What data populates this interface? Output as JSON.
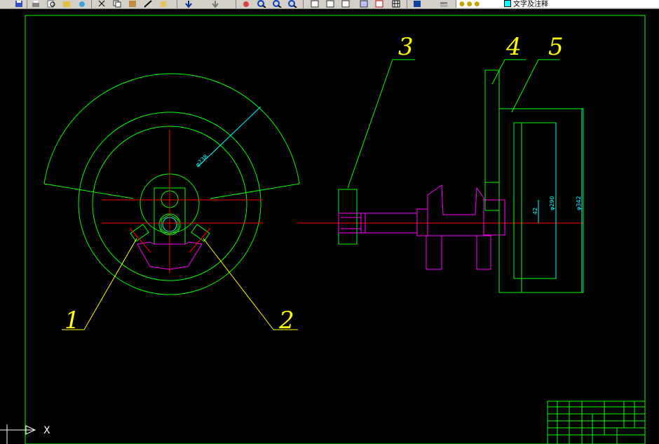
{
  "toolbar": {
    "buttons": [
      "save-icon",
      "print-icon",
      "preview-icon",
      "publish-icon",
      "3d-icon",
      "cut-icon",
      "copy-icon",
      "paste-icon",
      "match-icon",
      "brush-icon",
      "undo-icon",
      "redo-icon",
      "pan-icon",
      "zoom-realtime-icon",
      "zoom-window-icon",
      "zoom-previous-icon",
      "properties-icon",
      "designcenter-icon",
      "toolpalette-icon",
      "markup-icon",
      "calculator-icon",
      "help-icon",
      "layer-manager-icon"
    ],
    "layer_name": "文字及注释",
    "layer_color": "#00ffff"
  },
  "drawing": {
    "dim_labels": {
      "d1": "φ238",
      "d2": "φ290",
      "d3": "φ342",
      "d4": "42"
    },
    "part_labels": {
      "p1": "1",
      "p2": "2",
      "p3": "3",
      "p4": "4",
      "p5": "5"
    },
    "colors": {
      "frame": "#00ff00",
      "center": "#ff0000",
      "part": "#ff00ff",
      "leader": "#ffff00",
      "dim": "#00ffff"
    }
  },
  "ucs": {
    "x_label": "X"
  }
}
